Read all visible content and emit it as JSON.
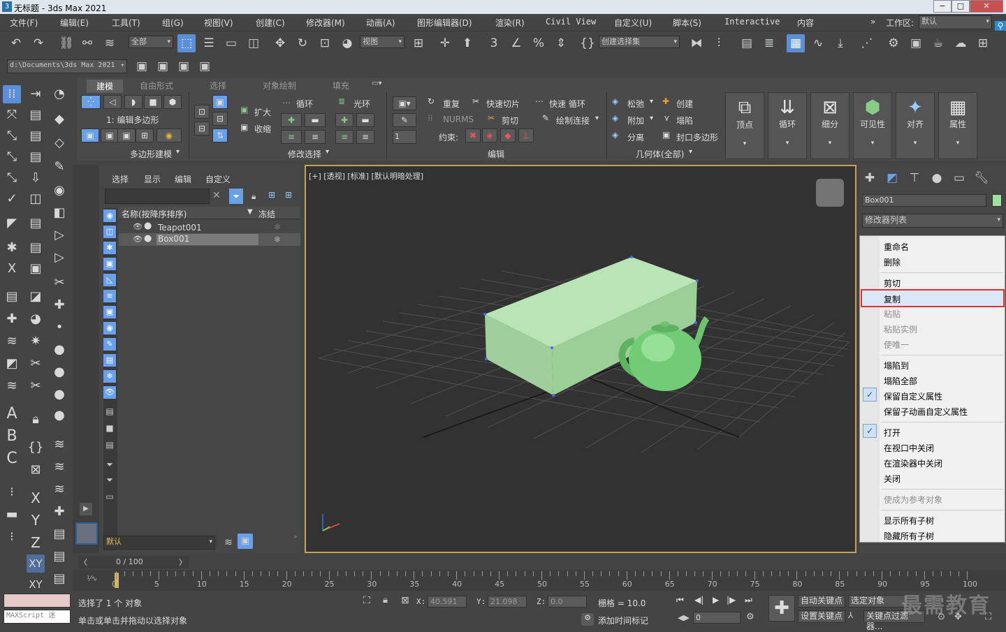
{
  "window": {
    "title": "无标题 - 3ds Max 2021",
    "min": "−",
    "max": "□",
    "close": "✕"
  },
  "menu": [
    "文件(F)",
    "编辑(E)",
    "工具(T)",
    "组(G)",
    "视图(V)",
    "创建(C)",
    "修改器(M)",
    "动画(A)",
    "图形编辑器(D)",
    "渲染(R)",
    "Civil View",
    "自定义(U)",
    "脚本(S)",
    "Interactive",
    "内容"
  ],
  "workspace": {
    "label": "工作区:",
    "value": "默认"
  },
  "toolbar": {
    "filter": "全部",
    "ref_coord": "视图",
    "selection_set": "创建选择集"
  },
  "project_path": "d:\\Documents\\3ds Max 2021",
  "ribbon": {
    "tabs": [
      "建模",
      "自由形式",
      "选择",
      "对象绘制",
      "填充"
    ],
    "selected_tab": "建模",
    "polymodel_label": "1: 编辑多边形",
    "group_polygon": "多边形建模",
    "group_modify_sel": "修改选择",
    "group_edit": "编辑",
    "group_geometry": "几何体(全部)",
    "expand": "扩大",
    "shrink": "收缩",
    "loop": "循环",
    "ring": "光环",
    "repeat": "重复",
    "quickslice": "快速切片",
    "quickloop": "快速 循环",
    "nurms": "NURMS",
    "cut": "剪切",
    "paintconnect": "绘制连接",
    "constraint": "约束:",
    "spinner_value": "1",
    "relax": "松弛",
    "create": "创建",
    "attach": "附加",
    "collapse": "塌陷",
    "detach": "分离",
    "cap": "封口多边形",
    "big_buttons": [
      "顶点",
      "循环",
      "细分",
      "可见性",
      "对齐",
      "属性"
    ]
  },
  "scene": {
    "tabs": [
      "选择",
      "显示",
      "编辑",
      "自定义"
    ],
    "col_name": "名称(按降序排序)",
    "col_freeze": "冻结",
    "objects": [
      "Teapot001",
      "Box001"
    ],
    "layer": "默认"
  },
  "viewport": {
    "label": "[+] [透视] [标准] [默认明暗处理]"
  },
  "command_panel": {
    "object_name": "Box001",
    "modifier_list": "修改器列表",
    "color": "#9fe0a0"
  },
  "context_menu": {
    "items": [
      {
        "label": "重命名",
        "disabled": false,
        "checked": false
      },
      {
        "label": "删除",
        "disabled": false,
        "checked": false
      },
      {
        "label": "剪切",
        "disabled": false,
        "checked": false
      },
      {
        "label": "复制",
        "disabled": false,
        "checked": false,
        "highlighted": true
      },
      {
        "label": "粘贴",
        "disabled": true,
        "checked": false
      },
      {
        "label": "粘贴实例",
        "disabled": true,
        "checked": false
      },
      {
        "label": "使唯一",
        "disabled": true,
        "checked": false
      },
      {
        "label": "塌陷到",
        "disabled": false,
        "checked": false
      },
      {
        "label": "塌陷全部",
        "disabled": false,
        "checked": false
      },
      {
        "label": "保留自定义属性",
        "disabled": false,
        "checked": true
      },
      {
        "label": "保留子动画自定义属性",
        "disabled": false,
        "checked": false
      },
      {
        "label": "打开",
        "disabled": false,
        "checked": true
      },
      {
        "label": "在视口中关闭",
        "disabled": false,
        "checked": false
      },
      {
        "label": "在渲染器中关闭",
        "disabled": false,
        "checked": false
      },
      {
        "label": "关闭",
        "disabled": false,
        "checked": false
      },
      {
        "label": "使成为参考对象",
        "disabled": true,
        "checked": false
      },
      {
        "label": "显示所有子树",
        "disabled": false,
        "checked": false
      },
      {
        "label": "隐藏所有子树",
        "disabled": false,
        "checked": false
      }
    ]
  },
  "timeline": {
    "frame_display": "0 / 100",
    "ticks": [
      "0",
      "5",
      "10",
      "15",
      "20",
      "25",
      "30",
      "35",
      "40",
      "45",
      "50",
      "55",
      "60",
      "65",
      "70",
      "75",
      "80",
      "85",
      "90",
      "95",
      "100"
    ]
  },
  "status": {
    "maxscript": "MAXScript 迷",
    "selected": "选择了 1 个 对象",
    "prompt": "单击或单击并拖动以选择对象",
    "x_label": "X:",
    "x": "40.591",
    "y_label": "Y:",
    "y": "21.098",
    "z_label": "Z:",
    "z": "0.0",
    "grid": "栅格 = 10.0",
    "add_time_tag": "添加时间标记",
    "auto_key": "自动关键点",
    "selected_obj": "选定对象",
    "set_key": "设置关键点",
    "key_filters": "关键点过滤器...",
    "frame_field": "0"
  },
  "watermark": "最需教育"
}
